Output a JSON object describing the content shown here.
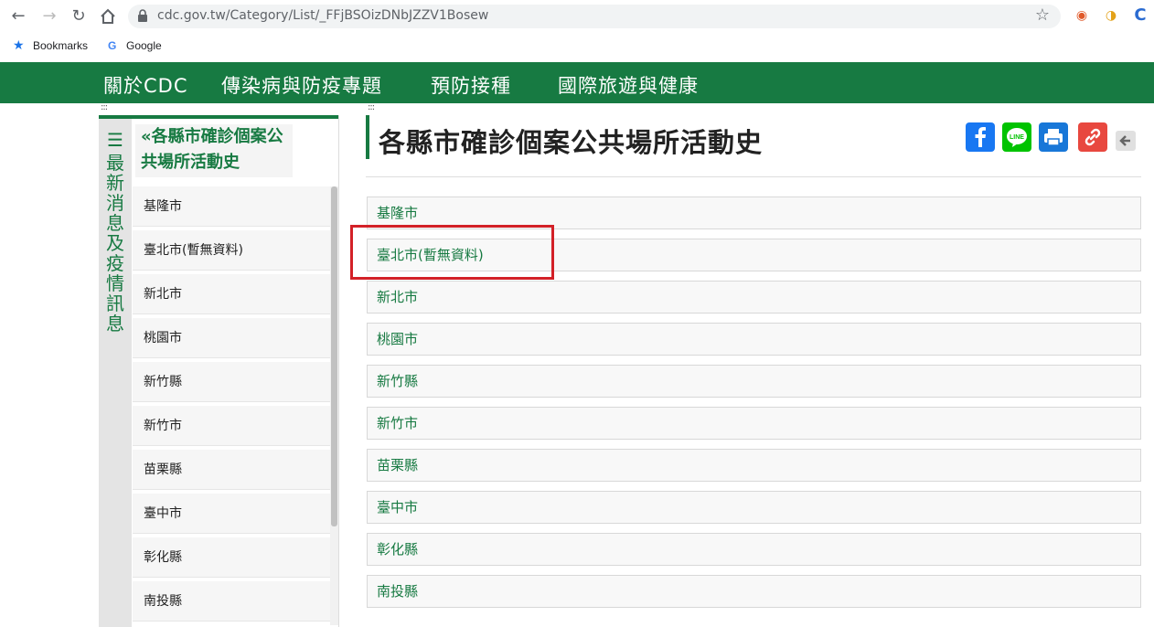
{
  "browser": {
    "url": "cdc.gov.tw/Category/List/_FFjBSOizDNbJZZV1Bosew",
    "bookmarks": [
      {
        "label": "Bookmarks",
        "icon": "star-icon"
      },
      {
        "label": "Google",
        "icon": "google-icon"
      }
    ]
  },
  "site_nav": {
    "items": [
      "關於CDC",
      "傳染病與防疫專題",
      "預防接種",
      "國際旅遊與健康"
    ],
    "color": "#177a42"
  },
  "sidebar": {
    "vertical_title": "最新消息及疫情訊息",
    "header": "«各縣市確診個案公共場所活動史",
    "items": [
      "基隆市",
      "臺北市(暫無資料)",
      "新北市",
      "桃園市",
      "新竹縣",
      "新竹市",
      "苗栗縣",
      "臺中市",
      "彰化縣",
      "南投縣"
    ]
  },
  "main": {
    "title": "各縣市確診個案公共場所活動史",
    "items": [
      "基隆市",
      "臺北市(暫無資料)",
      "新北市",
      "桃園市",
      "新竹縣",
      "新竹市",
      "苗栗縣",
      "臺中市",
      "彰化縣",
      "南投縣"
    ]
  },
  "share": {
    "facebook_color": "#1877f2",
    "line_color": "#00c300",
    "print_color": "#1877d8",
    "link_color": "#e8483f"
  },
  "highlight_color": "#d32128"
}
